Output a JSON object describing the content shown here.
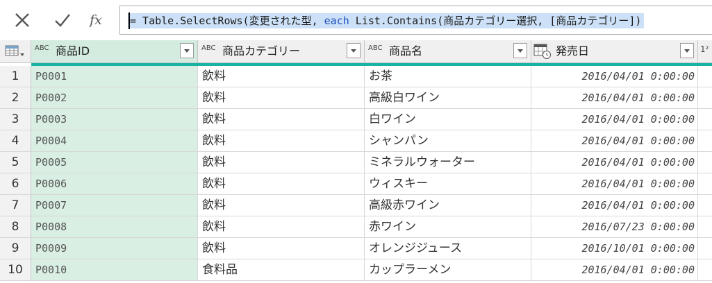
{
  "formula_bar": {
    "cancel_icon": "x-icon",
    "commit_icon": "check-icon",
    "fx_label": "fx",
    "prefix": "= Table.SelectRows(変更された型, ",
    "keyword": "each",
    "suffix": " List.Contains(商品カテゴリー選択, [商品カテゴリー])"
  },
  "columns": [
    {
      "type_label": "ABC",
      "name": "商品ID"
    },
    {
      "type_label": "ABC",
      "name": "商品カテゴリー"
    },
    {
      "type_label": "ABC",
      "name": "商品名"
    },
    {
      "type_label": "calendar-clock-icon",
      "name": "発売日"
    },
    {
      "type_label": "1²",
      "name": ""
    }
  ],
  "rows": [
    {
      "n": "1",
      "id": "P0001",
      "cat": "飲料",
      "name": "お茶",
      "date": "2016/04/01 0:00:00"
    },
    {
      "n": "2",
      "id": "P0002",
      "cat": "飲料",
      "name": "高級白ワイン",
      "date": "2016/04/01 0:00:00"
    },
    {
      "n": "3",
      "id": "P0003",
      "cat": "飲料",
      "name": "白ワイン",
      "date": "2016/04/01 0:00:00"
    },
    {
      "n": "4",
      "id": "P0004",
      "cat": "飲料",
      "name": "シャンパン",
      "date": "2016/04/01 0:00:00"
    },
    {
      "n": "5",
      "id": "P0005",
      "cat": "飲料",
      "name": "ミネラルウォーター",
      "date": "2016/04/01 0:00:00"
    },
    {
      "n": "6",
      "id": "P0006",
      "cat": "飲料",
      "name": "ウィスキー",
      "date": "2016/04/01 0:00:00"
    },
    {
      "n": "7",
      "id": "P0007",
      "cat": "飲料",
      "name": "高級赤ワイン",
      "date": "2016/04/01 0:00:00"
    },
    {
      "n": "8",
      "id": "P0008",
      "cat": "飲料",
      "name": "赤ワイン",
      "date": "2016/07/23 0:00:00"
    },
    {
      "n": "9",
      "id": "P0009",
      "cat": "飲料",
      "name": "オレンジジュース",
      "date": "2016/10/01 0:00:00"
    },
    {
      "n": "10",
      "id": "P0010",
      "cat": "食料品",
      "name": "カップラーメン",
      "date": "2016/04/01 0:00:00"
    }
  ],
  "colors": {
    "accent": "#1ab3a3",
    "selected_column": "#d9efe3",
    "selection": "#cce1f7"
  }
}
